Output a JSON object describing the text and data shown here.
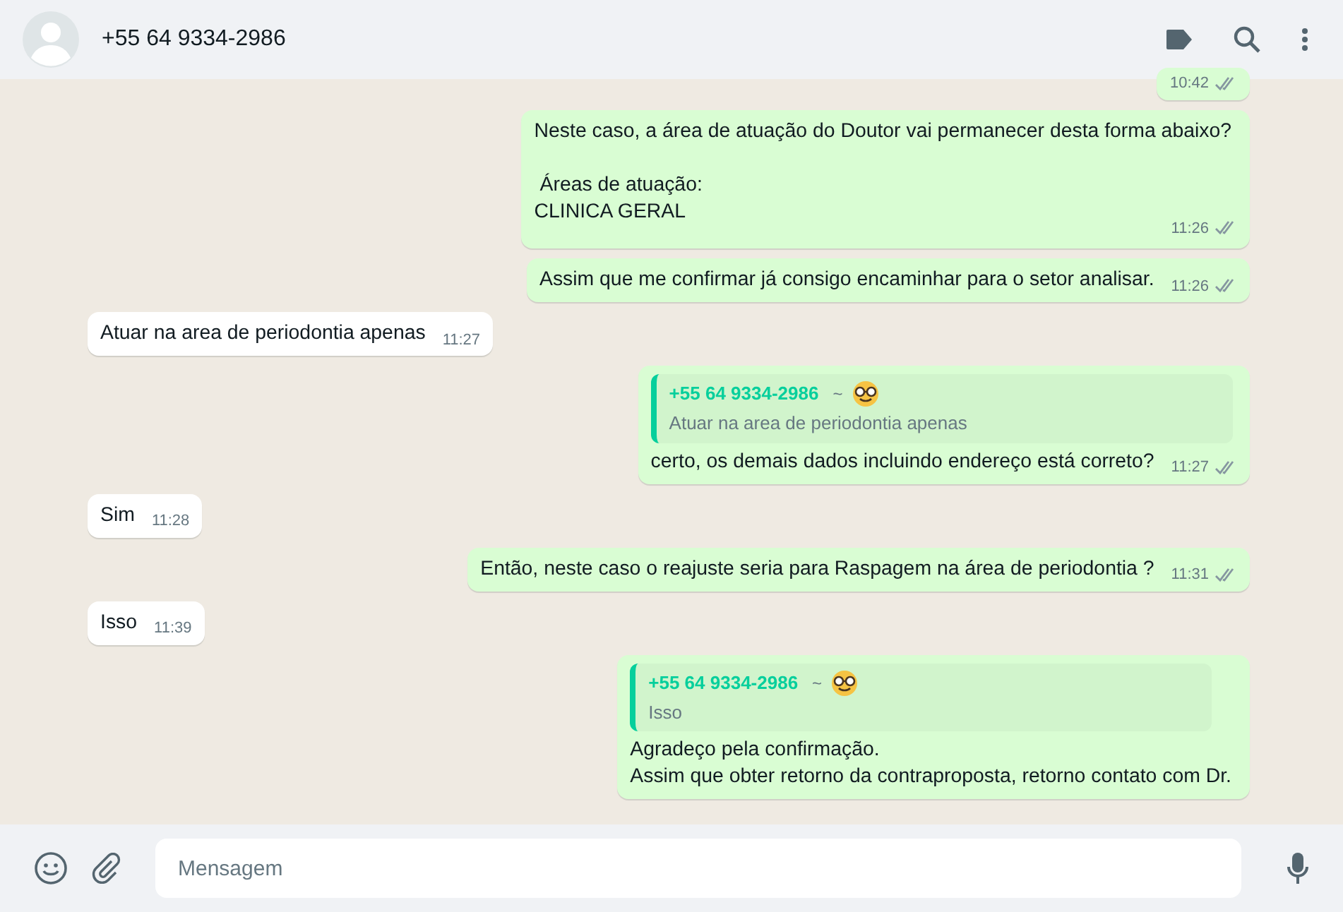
{
  "header": {
    "contact": "+55 64 9334-2986"
  },
  "messages": [
    {
      "kind": "out",
      "time": "10:42"
    },
    {
      "kind": "out",
      "lines": [
        "Neste caso, a área de atuação do Doutor vai permanecer desta forma abaixo?\n\n Áreas de atuação:\nCLINICA GERAL"
      ],
      "time": "11:26"
    },
    {
      "kind": "out",
      "lines": [
        "Assim que me confirmar já consigo encaminhar para o setor analisar."
      ],
      "time": "11:26"
    },
    {
      "kind": "in",
      "lines": [
        "Atuar na area de periodontia apenas"
      ],
      "time": "11:27"
    },
    {
      "kind": "out",
      "quote": {
        "author": "+55 64 9334-2986",
        "tilde": "~",
        "text": "Atuar na area de periodontia apenas"
      },
      "lines": [
        "certo, os demais dados incluindo endereço está correto?"
      ],
      "time": "11:27"
    },
    {
      "kind": "in",
      "lines": [
        "Sim"
      ],
      "time": "11:28"
    },
    {
      "kind": "out",
      "lines": [
        "Então, neste caso o reajuste seria para Raspagem na área de periodontia ?"
      ],
      "time": "11:31"
    },
    {
      "kind": "in",
      "lines": [
        "Isso"
      ],
      "time": "11:39"
    },
    {
      "kind": "out",
      "quote": {
        "author": "+55 64 9334-2986",
        "tilde": "~",
        "text": "Isso"
      },
      "lines": [
        "Agradeço pela confirmação.",
        "Assim que obter retorno da contraproposta, retorno contato com Dr."
      ]
    }
  ],
  "composer": {
    "placeholder": "Mensagem"
  }
}
